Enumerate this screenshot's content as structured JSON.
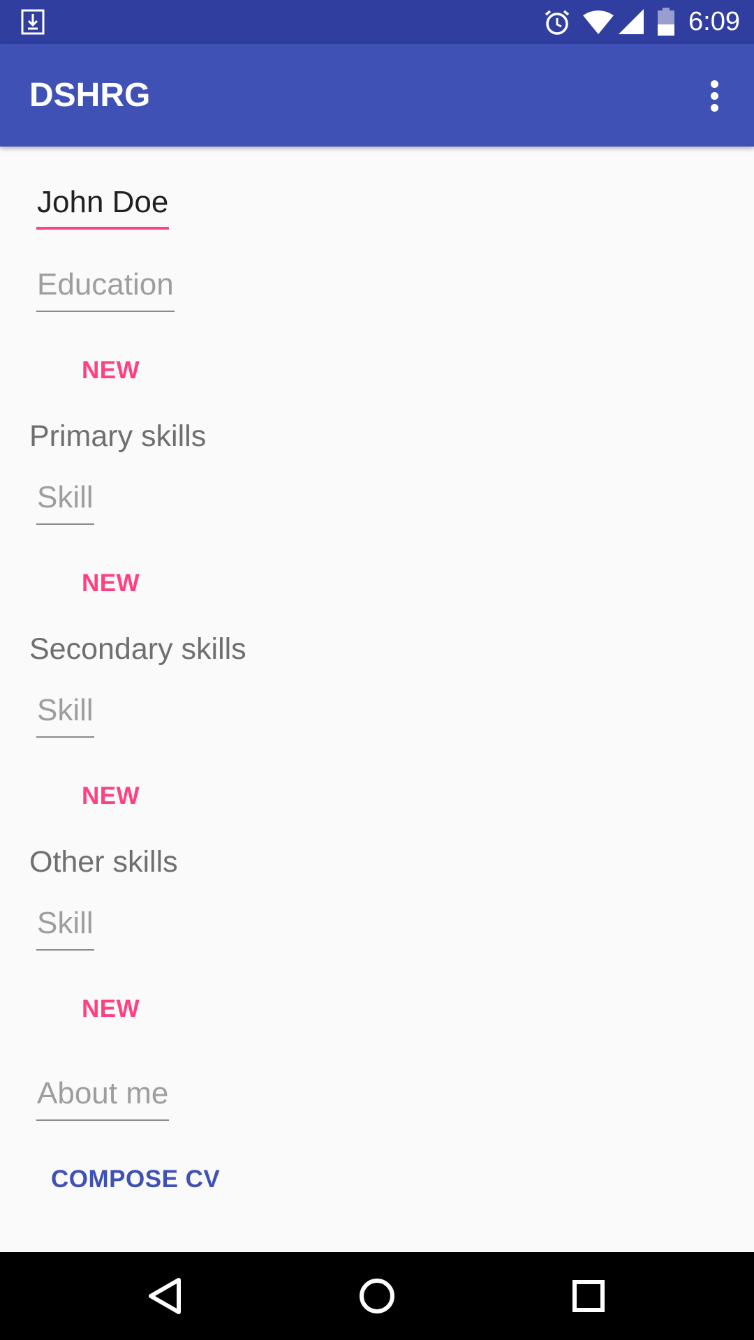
{
  "status_bar": {
    "time": "6:09",
    "icons": [
      "download-icon",
      "alarm-icon",
      "wifi-icon",
      "signal-icon",
      "battery-icon"
    ],
    "background": "#303f9f"
  },
  "app_bar": {
    "title": "DSHRG",
    "menu_icon": "more-vert-icon",
    "background": "#3f51b5"
  },
  "form": {
    "name_value": "John Doe",
    "education_placeholder": "Education",
    "education_new_label": "NEW",
    "primary_skills": {
      "label": "Primary skills",
      "skill_placeholder": "Skill",
      "new_label": "NEW"
    },
    "secondary_skills": {
      "label": "Secondary skills",
      "skill_placeholder": "Skill",
      "new_label": "NEW"
    },
    "other_skills": {
      "label": "Other skills",
      "skill_placeholder": "Skill",
      "new_label": "NEW"
    },
    "about_placeholder": "About me",
    "compose_label": "COMPOSE CV"
  },
  "nav_bar": {
    "icons": [
      "back-icon",
      "home-icon",
      "recents-icon"
    ]
  },
  "colors": {
    "accent": "#ff4081",
    "primary": "#3f51b5",
    "primary_dark": "#303f9f"
  }
}
